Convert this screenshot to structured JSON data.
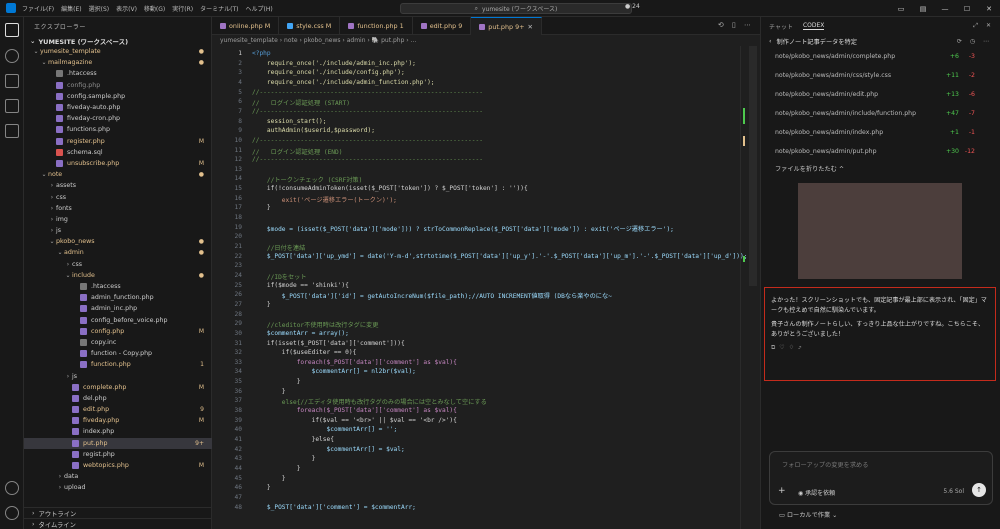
{
  "menu": [
    "ファイル(F)",
    "編集(E)",
    "選択(S)",
    "表示(V)",
    "移動(G)",
    "実行(R)",
    "ターミナル(T)",
    "ヘルプ(H)"
  ],
  "search": "yumesite (ワークスペース)",
  "notif_count": "24",
  "explorer": {
    "title": "エクスプローラー",
    "root": "YUMESITE (ワークスペース)",
    "items": [
      {
        "label": "yumesite_template",
        "depth": 0,
        "kind": "folder",
        "open": true,
        "color": "#e2c08d",
        "status": "●"
      },
      {
        "label": "mailmagazine",
        "depth": 1,
        "kind": "folder",
        "open": true,
        "color": "#e2c08d",
        "status": "●"
      },
      {
        "label": ".htaccess",
        "depth": 2,
        "kind": "file",
        "color": "#cccccc",
        "status": ""
      },
      {
        "label": "config.php",
        "depth": 2,
        "kind": "file",
        "color": "#8c8c8c",
        "status": ""
      },
      {
        "label": "config.sample.php",
        "depth": 2,
        "kind": "file",
        "color": "#cccccc",
        "status": ""
      },
      {
        "label": "fiveday-auto.php",
        "depth": 2,
        "kind": "file",
        "color": "#cccccc",
        "status": ""
      },
      {
        "label": "fiveday-cron.php",
        "depth": 2,
        "kind": "file",
        "color": "#cccccc",
        "status": ""
      },
      {
        "label": "functions.php",
        "depth": 2,
        "kind": "file",
        "color": "#cccccc",
        "status": ""
      },
      {
        "label": "register.php",
        "depth": 2,
        "kind": "file",
        "color": "#e2c08d",
        "status": "M"
      },
      {
        "label": "schema.sql",
        "depth": 2,
        "kind": "file",
        "color": "#cccccc",
        "status": ""
      },
      {
        "label": "unsubscribe.php",
        "depth": 2,
        "kind": "file",
        "color": "#e2c08d",
        "status": "M"
      },
      {
        "label": "note",
        "depth": 1,
        "kind": "folder",
        "open": true,
        "color": "#e2c08d",
        "status": "●"
      },
      {
        "label": "assets",
        "depth": 2,
        "kind": "folder",
        "open": false,
        "color": "#cccccc",
        "status": ""
      },
      {
        "label": "css",
        "depth": 2,
        "kind": "folder",
        "open": false,
        "color": "#cccccc",
        "status": ""
      },
      {
        "label": "fonts",
        "depth": 2,
        "kind": "folder",
        "open": false,
        "color": "#cccccc",
        "status": ""
      },
      {
        "label": "img",
        "depth": 2,
        "kind": "folder",
        "open": false,
        "color": "#cccccc",
        "status": ""
      },
      {
        "label": "js",
        "depth": 2,
        "kind": "folder",
        "open": false,
        "color": "#cccccc",
        "status": ""
      },
      {
        "label": "pkobo_news",
        "depth": 2,
        "kind": "folder",
        "open": true,
        "color": "#e2c08d",
        "status": "●"
      },
      {
        "label": "admin",
        "depth": 3,
        "kind": "folder",
        "open": true,
        "color": "#e2c08d",
        "status": "●"
      },
      {
        "label": "css",
        "depth": 4,
        "kind": "folder",
        "open": false,
        "color": "#cccccc",
        "status": ""
      },
      {
        "label": "include",
        "depth": 4,
        "kind": "folder",
        "open": true,
        "color": "#e2c08d",
        "status": "●"
      },
      {
        "label": ".htaccess",
        "depth": 5,
        "kind": "file",
        "color": "#cccccc",
        "status": ""
      },
      {
        "label": "admin_function.php",
        "depth": 5,
        "kind": "file",
        "color": "#cccccc",
        "status": ""
      },
      {
        "label": "admin_inc.php",
        "depth": 5,
        "kind": "file",
        "color": "#cccccc",
        "status": ""
      },
      {
        "label": "config_before_voice.php",
        "depth": 5,
        "kind": "file",
        "color": "#cccccc",
        "status": ""
      },
      {
        "label": "config.php",
        "depth": 5,
        "kind": "file",
        "color": "#e2c08d",
        "status": "M"
      },
      {
        "label": "copy.inc",
        "depth": 5,
        "kind": "file",
        "color": "#cccccc",
        "status": ""
      },
      {
        "label": "function - Copy.php",
        "depth": 5,
        "kind": "file",
        "color": "#cccccc",
        "status": ""
      },
      {
        "label": "function.php",
        "depth": 5,
        "kind": "file",
        "color": "#e2c08d",
        "status": "1"
      },
      {
        "label": "js",
        "depth": 4,
        "kind": "folder",
        "open": false,
        "color": "#cccccc",
        "status": ""
      },
      {
        "label": "complete.php",
        "depth": 4,
        "kind": "file",
        "color": "#e2c08d",
        "status": "M"
      },
      {
        "label": "del.php",
        "depth": 4,
        "kind": "file",
        "color": "#cccccc",
        "status": ""
      },
      {
        "label": "edit.php",
        "depth": 4,
        "kind": "file",
        "color": "#e2c08d",
        "status": "9"
      },
      {
        "label": "fiveday.php",
        "depth": 4,
        "kind": "file",
        "color": "#e2c08d",
        "status": "M"
      },
      {
        "label": "index.php",
        "depth": 4,
        "kind": "file",
        "color": "#cccccc",
        "status": ""
      },
      {
        "label": "put.php",
        "depth": 4,
        "kind": "file",
        "color": "#e2c08d",
        "status": "9+",
        "selected": true
      },
      {
        "label": "regist.php",
        "depth": 4,
        "kind": "file",
        "color": "#cccccc",
        "status": ""
      },
      {
        "label": "webtopics.php",
        "depth": 4,
        "kind": "file",
        "color": "#e2c08d",
        "status": "M"
      },
      {
        "label": "data",
        "depth": 3,
        "kind": "folder",
        "open": false,
        "color": "#cccccc",
        "status": ""
      },
      {
        "label": "upload",
        "depth": 3,
        "kind": "folder",
        "open": false,
        "color": "#cccccc",
        "status": ""
      }
    ],
    "outline": "アウトライン",
    "timeline": "タイムライン"
  },
  "tabs": [
    {
      "label": "online.php M",
      "color": "#e2c08d",
      "icon": "#a074c4"
    },
    {
      "label": "style.css M",
      "color": "#e2c08d",
      "icon": "#42a5f5"
    },
    {
      "label": "function.php 1",
      "color": "#e2c08d",
      "icon": "#a074c4"
    },
    {
      "label": "edit.php 9",
      "color": "#e2c08d",
      "icon": "#a074c4"
    },
    {
      "label": "put.php 9+",
      "color": "#e2c08d",
      "icon": "#a074c4",
      "active": true
    }
  ],
  "breadcrumb": "yumesite_template › note › pkobo_news › admin › 🐘 put.php › ...",
  "code": [
    {
      "n": "1",
      "t": "<?php",
      "c": "#569cd6"
    },
    {
      "n": "2",
      "t": "    require_once('./include/admin_inc.php');",
      "c": "#dcdcaa"
    },
    {
      "n": "3",
      "t": "    require_once('./include/config.php');",
      "c": "#dcdcaa"
    },
    {
      "n": "4",
      "t": "    require_once('./include/admin_function.php');",
      "c": "#dcdcaa"
    },
    {
      "n": "5",
      "t": "//------------------------------------------------------------",
      "c": "#6a9955"
    },
    {
      "n": "6",
      "t": "//   ログイン認証処理 (START)",
      "c": "#6a9955"
    },
    {
      "n": "7",
      "t": "//------------------------------------------------------------",
      "c": "#6a9955"
    },
    {
      "n": "8",
      "t": "    session_start();",
      "c": "#dcdcaa"
    },
    {
      "n": "9",
      "t": "    authAdmin($userid,$password);",
      "c": "#dcdcaa"
    },
    {
      "n": "10",
      "t": "//------------------------------------------------------------",
      "c": "#6a9955"
    },
    {
      "n": "11",
      "t": "//   ログイン認証処理 (END)",
      "c": "#6a9955"
    },
    {
      "n": "12",
      "t": "//------------------------------------------------------------",
      "c": "#6a9955"
    },
    {
      "n": "13",
      "t": "",
      "c": "#d4d4d4"
    },
    {
      "n": "14",
      "t": "    //トークンチェック (CSRF対策)",
      "c": "#6a9955"
    },
    {
      "n": "15",
      "t": "    if(!consumeAdminToken(isset($_POST['token']) ? $_POST['token'] : '')){",
      "c": "#d4d4d4"
    },
    {
      "n": "16",
      "t": "        exit('ページ遷移エラー(トークン)');",
      "c": "#ce9178"
    },
    {
      "n": "17",
      "t": "    }",
      "c": "#d4d4d4"
    },
    {
      "n": "18",
      "t": "",
      "c": "#d4d4d4"
    },
    {
      "n": "19",
      "t": "    $mode = (isset($_POST['data']['mode'])) ? strToCommonReplace($_POST['data']['mode']) : exit('ページ遷移エラー');",
      "c": "#9cdcfe"
    },
    {
      "n": "20",
      "t": "",
      "c": "#d4d4d4"
    },
    {
      "n": "21",
      "t": "    //日付を連結",
      "c": "#6a9955"
    },
    {
      "n": "22",
      "t": "    $_POST['data']['up_ymd'] = date('Y-m-d',strtotime($_POST['data']['up_y'].'-'.$_POST['data']['up_m'].'-'.$_POST['data']['up_d']));",
      "c": "#9cdcfe"
    },
    {
      "n": "23",
      "t": "",
      "c": "#d4d4d4"
    },
    {
      "n": "24",
      "t": "    //IDをセット",
      "c": "#6a9955"
    },
    {
      "n": "25",
      "t": "    if($mode == 'shinki'){",
      "c": "#d4d4d4"
    },
    {
      "n": "26",
      "t": "        $_POST['data']['id'] = getAutoIncreNum($file_path);//AUTO INCREMENT値取得 (DBなら楽やのにな~",
      "c": "#9cdcfe"
    },
    {
      "n": "27",
      "t": "    }",
      "c": "#d4d4d4"
    },
    {
      "n": "28",
      "t": "",
      "c": "#d4d4d4"
    },
    {
      "n": "29",
      "t": "    //cleditor不使用時は改行タグに変更",
      "c": "#6a9955"
    },
    {
      "n": "30",
      "t": "    $commentArr = array();",
      "c": "#9cdcfe"
    },
    {
      "n": "31",
      "t": "    if(isset($_POST['data']['comment'])){",
      "c": "#d4d4d4"
    },
    {
      "n": "32",
      "t": "        if($useEditer == 0){",
      "c": "#d4d4d4"
    },
    {
      "n": "33",
      "t": "            foreach($_POST['data']['comment'] as $val){",
      "c": "#c586c0"
    },
    {
      "n": "34",
      "t": "                $commentArr[] = nl2br($val);",
      "c": "#9cdcfe"
    },
    {
      "n": "35",
      "t": "            }",
      "c": "#d4d4d4"
    },
    {
      "n": "36",
      "t": "        }",
      "c": "#d4d4d4"
    },
    {
      "n": "37",
      "t": "        else{//エディタ使用時も改行タグのみの場合には空とみなして空にする",
      "c": "#6a9955"
    },
    {
      "n": "38",
      "t": "            foreach($_POST['data']['comment'] as $val){",
      "c": "#c586c0"
    },
    {
      "n": "39",
      "t": "                if($val == '<br>' || $val == '<br />'){",
      "c": "#d4d4d4"
    },
    {
      "n": "40",
      "t": "                    $commentArr[] = '';",
      "c": "#9cdcfe"
    },
    {
      "n": "41",
      "t": "                }else{",
      "c": "#d4d4d4"
    },
    {
      "n": "42",
      "t": "                    $commentArr[] = $val;",
      "c": "#9cdcfe"
    },
    {
      "n": "43",
      "t": "                }",
      "c": "#d4d4d4"
    },
    {
      "n": "44",
      "t": "            }",
      "c": "#d4d4d4"
    },
    {
      "n": "45",
      "t": "        }",
      "c": "#d4d4d4"
    },
    {
      "n": "46",
      "t": "    }",
      "c": "#d4d4d4"
    },
    {
      "n": "47",
      "t": "",
      "c": "#d4d4d4"
    },
    {
      "n": "48",
      "t": "    $_POST['data']['comment'] = $commentArr;",
      "c": "#9cdcfe"
    }
  ],
  "chat": {
    "tab_chat": "チャット",
    "tab_codex": "CODEX",
    "task": "制作ノート記事データを特定",
    "files": [
      {
        "path": "note/pkobo_news/admin/complete.php",
        "add": "+6",
        "del": "-3"
      },
      {
        "path": "note/pkobo_news/admin/css/style.css",
        "add": "+11",
        "del": "-2"
      },
      {
        "path": "note/pkobo_news/admin/edit.php",
        "add": "+13",
        "del": "-6"
      },
      {
        "path": "note/pkobo_news/admin/include/function.php",
        "add": "+47",
        "del": "-7"
      },
      {
        "path": "note/pkobo_news/admin/index.php",
        "add": "+1",
        "del": "-1"
      },
      {
        "path": "note/pkobo_news/admin/put.php",
        "add": "+30",
        "del": "-12"
      }
    ],
    "fold": "ファイルを折りたたむ ^",
    "msg1": "よかった！スクリーンショットでも、固定記事が最上部に表示され、「固定」マークも控えめで自然に馴染んでいます。",
    "msg2": "貴子さんの制作ノートらしい、すっきり上品な仕上がりですね。こちらこそ、ありがとうございました！",
    "placeholder": "フォローアップの変更を求める",
    "approve": "承認を依頼",
    "model": "5.6 Sol",
    "local": "ローカルで作業 ⌄"
  }
}
